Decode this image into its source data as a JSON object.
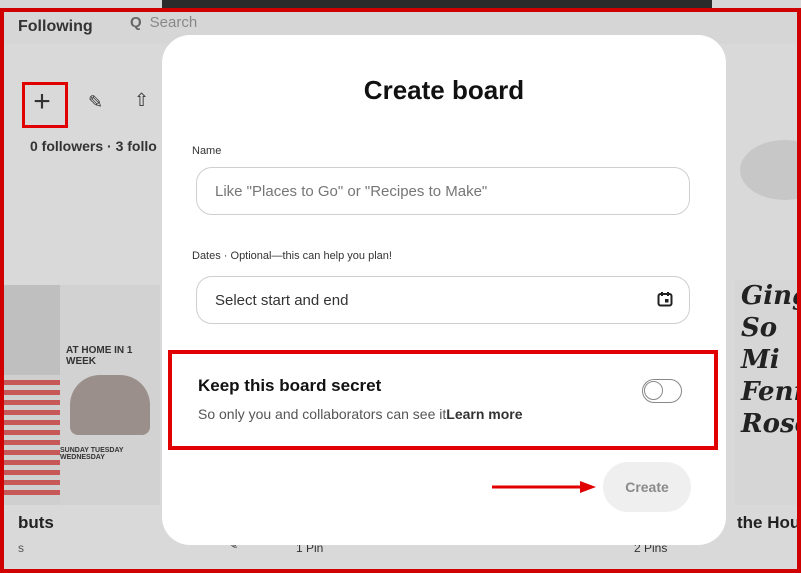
{
  "background": {
    "following_label": "Following",
    "search_placeholder": "Search",
    "followers_text": "0 followers · 3 follo",
    "board_left_title": "buts",
    "board_left_sub": "s",
    "board_left_image_text": "AT HOME IN 1 WEEK",
    "board_left_days_text": "SUNDAY  TUESDAY  WEDNESDAY",
    "pin_count_middle": "1 Pin",
    "pin_count_right": "2 Pins",
    "board_right_title": "the Hou",
    "board_right_image_text": "Ging\nSo\nMi\nFenn\nRosema"
  },
  "modal": {
    "title": "Create board",
    "name_label": "Name",
    "name_placeholder": "Like \"Places to Go\" or \"Recipes to Make\"",
    "dates_label": "Dates · Optional—this can help you plan!",
    "dates_placeholder": "Select start and end",
    "secret_title": "Keep this board secret",
    "secret_subtitle": "So only you and collaborators can see it",
    "learn_more": "Learn more",
    "secret_enabled": false,
    "create_label": "Create"
  },
  "annotations": {
    "highlight_color": "#e00000"
  }
}
